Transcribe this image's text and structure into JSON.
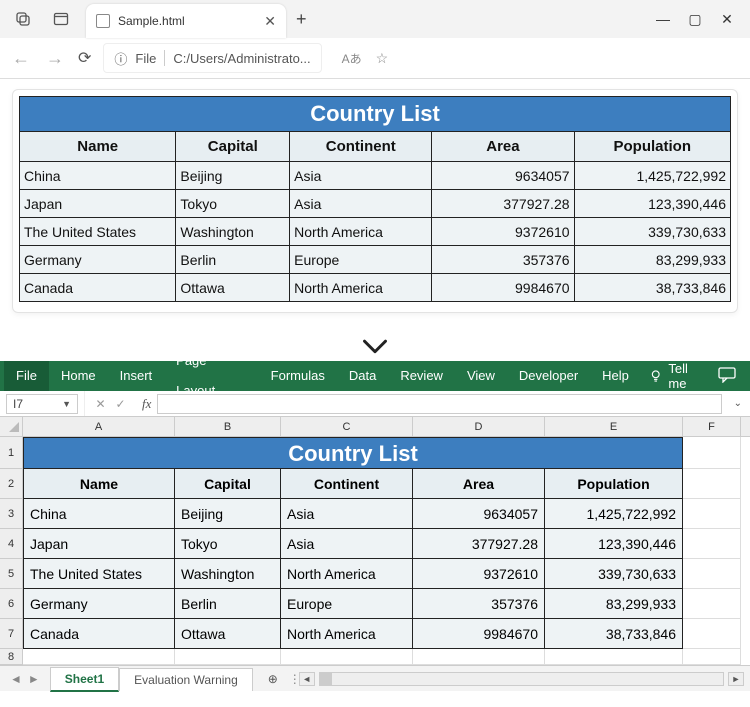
{
  "browser": {
    "tab_title": "Sample.html",
    "url_scheme_label": "File",
    "url_path": "C:/Users/Administrato...",
    "reader_icon": "Aあ"
  },
  "page": {
    "title": "Country List",
    "columns": [
      "Name",
      "Capital",
      "Continent",
      "Area",
      "Population"
    ],
    "rows": [
      {
        "name": "China",
        "capital": "Beijing",
        "continent": "Asia",
        "area": "9634057",
        "population": "1,425,722,992"
      },
      {
        "name": "Japan",
        "capital": "Tokyo",
        "continent": "Asia",
        "area": "377927.28",
        "population": "123,390,446"
      },
      {
        "name": "The United States",
        "capital": "Washington",
        "continent": "North America",
        "area": "9372610",
        "population": "339,730,633"
      },
      {
        "name": "Germany",
        "capital": "Berlin",
        "continent": "Europe",
        "area": "357376",
        "population": "83,299,933"
      },
      {
        "name": "Canada",
        "capital": "Ottawa",
        "continent": "North America",
        "area": "9984670",
        "population": "38,733,846"
      }
    ]
  },
  "excel": {
    "ribbon": [
      "File",
      "Home",
      "Insert",
      "Page Layout",
      "Formulas",
      "Data",
      "Review",
      "View",
      "Developer",
      "Help"
    ],
    "tell_me": "Tell me",
    "name_box": "I7",
    "fx_label": "fx",
    "col_headers": [
      "A",
      "B",
      "C",
      "D",
      "E",
      "F"
    ],
    "row_headers": [
      "1",
      "2",
      "3",
      "4",
      "5",
      "6",
      "7",
      "8"
    ],
    "title": "Country List",
    "columns": [
      "Name",
      "Capital",
      "Continent",
      "Area",
      "Population"
    ],
    "rows": [
      {
        "name": "China",
        "capital": "Beijing",
        "continent": "Asia",
        "area": "9634057",
        "population": "1,425,722,992"
      },
      {
        "name": "Japan",
        "capital": "Tokyo",
        "continent": "Asia",
        "area": "377927.28",
        "population": "123,390,446"
      },
      {
        "name": "The United States",
        "capital": "Washington",
        "continent": "North America",
        "area": "9372610",
        "population": "339,730,633"
      },
      {
        "name": "Germany",
        "capital": "Berlin",
        "continent": "Europe",
        "area": "357376",
        "population": "83,299,933"
      },
      {
        "name": "Canada",
        "capital": "Ottawa",
        "continent": "North America",
        "area": "9984670",
        "population": "38,733,846"
      }
    ],
    "sheets": [
      "Sheet1",
      "Evaluation Warning"
    ],
    "active_sheet": 0
  }
}
